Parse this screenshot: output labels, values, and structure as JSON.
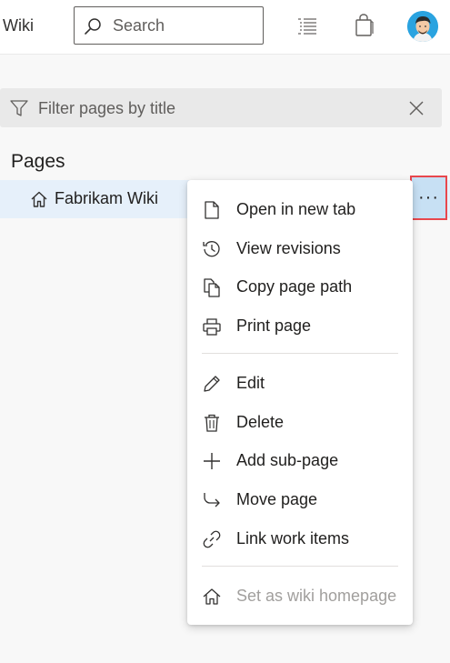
{
  "header": {
    "app_title": "Wiki",
    "search": {
      "placeholder": "Search",
      "value": ""
    }
  },
  "filter": {
    "placeholder": "Filter pages by title",
    "value": ""
  },
  "pages": {
    "heading": "Pages",
    "items": [
      {
        "label": "Fabrikam Wiki"
      }
    ]
  },
  "more_button": {
    "label": "···"
  },
  "context_menu": {
    "items": [
      {
        "label": "Open in new tab",
        "icon": "page-icon"
      },
      {
        "label": "View revisions",
        "icon": "history-icon"
      },
      {
        "label": "Copy page path",
        "icon": "copy-icon"
      },
      {
        "label": "Print page",
        "icon": "print-icon"
      },
      {
        "label": "Edit",
        "icon": "pencil-icon"
      },
      {
        "label": "Delete",
        "icon": "trash-icon"
      },
      {
        "label": "Add sub-page",
        "icon": "plus-icon"
      },
      {
        "label": "Move page",
        "icon": "move-arrow-icon"
      },
      {
        "label": "Link work items",
        "icon": "link-icon"
      },
      {
        "label": "Set as wiki homepage",
        "icon": "home-icon",
        "disabled": true
      }
    ]
  },
  "colors": {
    "selected_row": "#e6f0fa",
    "highlight_border": "#e8474d",
    "more_button_bg": "#c7e0f4",
    "disabled_text": "#a19f9d"
  }
}
